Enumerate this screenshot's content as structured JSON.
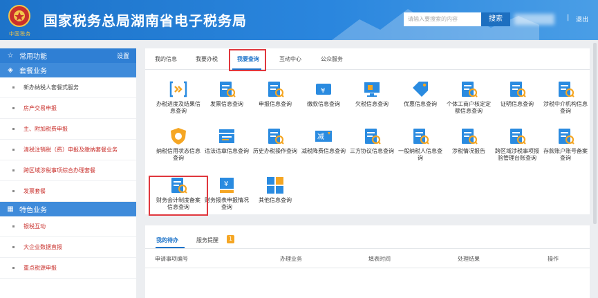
{
  "header": {
    "title": "国家税务总局湖南省电子税务局",
    "brand_text": "中国税务",
    "search_placeholder": "请输入要搜索的内容",
    "search_button": "搜索",
    "separator": "|",
    "logout": "退出"
  },
  "sidebar": {
    "common": {
      "label": "常用功能",
      "settings": "设置"
    },
    "package": {
      "label": "套餐业务",
      "items": [
        "新办纳税人套餐式服务",
        "房产交易申报",
        "主、附加税费申报",
        "清税注销税（费）申报及缴纳套餐业务",
        "跨区域涉税事项综合办理套餐",
        "发票套餐"
      ]
    },
    "featured": {
      "label": "特色业务",
      "items": [
        "银税互动",
        "大企业数据直报",
        "重点税源申报"
      ]
    }
  },
  "tabs": [
    "我的信息",
    "我要办税",
    "我要查询",
    "互动中心",
    "公众服务"
  ],
  "services": [
    {
      "label": "办税进度及结果信息查询",
      "icon": "progress-icon",
      "color": "#2a8be0"
    },
    {
      "label": "发票信息查询",
      "icon": "invoice-search-icon",
      "color": "#2a8be0"
    },
    {
      "label": "申报信息查询",
      "icon": "declare-search-icon",
      "color": "#2a8be0"
    },
    {
      "label": "缴款信息查询",
      "icon": "payment-icon",
      "color": "#2a8be0"
    },
    {
      "label": "欠税信息查询",
      "icon": "monitor-icon",
      "color": "#2a8be0"
    },
    {
      "label": "优惠信息查询",
      "icon": "tag-icon",
      "color": "#2a8be0"
    },
    {
      "label": "个体工商户核定定额信息查询",
      "icon": "business-search-icon",
      "color": "#2a8be0"
    },
    {
      "label": "证明信息查询",
      "icon": "certificate-icon",
      "color": "#2a8be0"
    },
    {
      "label": "涉税中介机构信息查询",
      "icon": "agency-icon",
      "color": "#2a8be0"
    },
    {
      "label": "纳税信用状态信息查询",
      "icon": "credit-shield-icon",
      "color": "#f5a623"
    },
    {
      "label": "违法违章信息查询",
      "icon": "violation-icon",
      "color": "#2a8be0"
    },
    {
      "label": "历史办税操作查询",
      "icon": "history-icon",
      "color": "#2a8be0"
    },
    {
      "label": "减税降费信息查询",
      "icon": "tax-reduce-icon",
      "color": "#2a8be0"
    },
    {
      "label": "三方协议信息查询",
      "icon": "agreement-icon",
      "color": "#2a8be0"
    },
    {
      "label": "一般纳税人信息查询",
      "icon": "taxpayer-icon",
      "color": "#2a8be0"
    },
    {
      "label": "涉税情况报告",
      "icon": "report-icon",
      "color": "#2a8be0"
    },
    {
      "label": "跨区域涉税事项报验管理台账查询",
      "icon": "cross-region-icon",
      "color": "#2a8be0"
    },
    {
      "label": "存款账户账号备案查询",
      "icon": "deposit-icon",
      "color": "#2a8be0"
    },
    {
      "label": "财务会计制度备案信息查询",
      "icon": "accounting-icon",
      "color": "#2a8be0"
    },
    {
      "label": "财务报表申报情况查询",
      "icon": "financial-report-icon",
      "color": "#2a8be0"
    },
    {
      "label": "其他信息查询",
      "icon": "grid-icon",
      "color": "#2a8be0"
    }
  ],
  "bottom": {
    "tabs": [
      "我的待办",
      "服务提醒"
    ],
    "badge": "1",
    "columns": [
      "申请事项编号",
      "办理业务",
      "填表时间",
      "处理结果",
      "操作"
    ]
  }
}
